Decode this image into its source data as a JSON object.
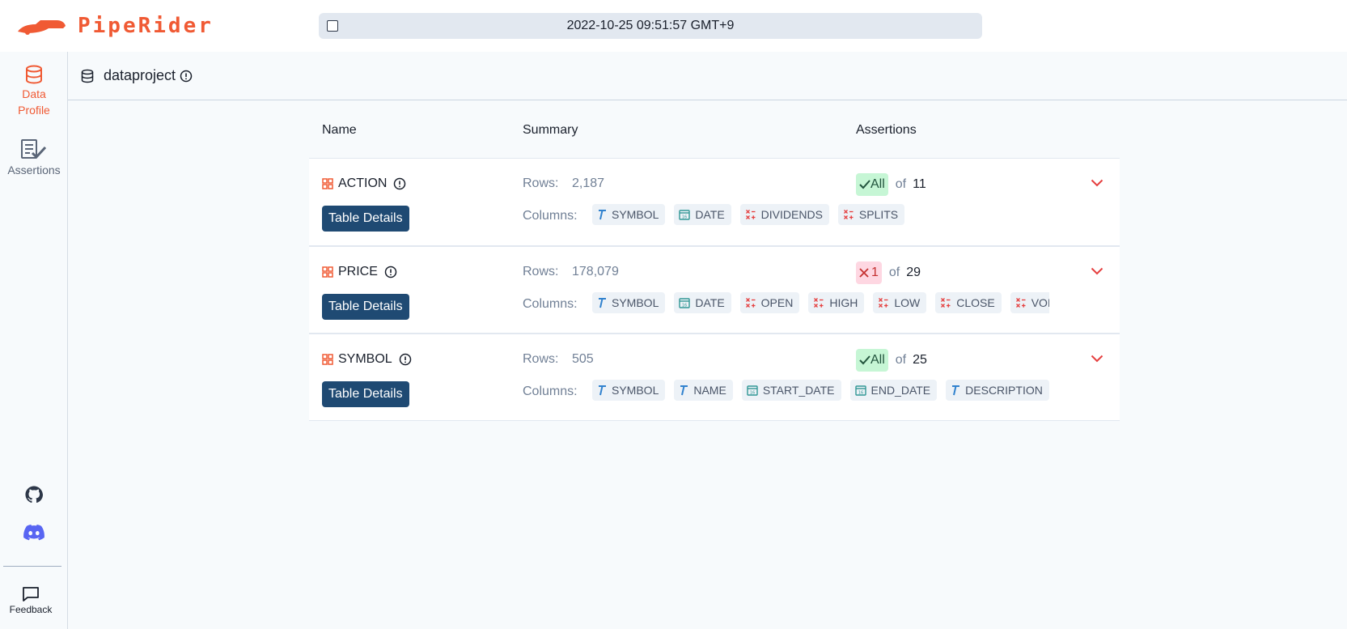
{
  "app": {
    "logo_text": "PipeRider",
    "timestamp": "2022-10-25 09:51:57 GMT+9"
  },
  "sidebar": {
    "items": [
      {
        "label_line1": "Data",
        "label_line2": "Profile",
        "icon": "database-icon",
        "active": true
      },
      {
        "label": "Assertions",
        "icon": "assertions-icon",
        "active": false
      }
    ],
    "social": [
      "github-icon",
      "discord-icon"
    ],
    "feedback_label": "Feedback"
  },
  "breadcrumb": {
    "title": "dataproject"
  },
  "table": {
    "headers": {
      "name": "Name",
      "summary": "Summary",
      "assertions": "Assertions"
    },
    "details_label": "Table Details",
    "rows_label": "Rows:",
    "columns_label": "Columns:",
    "of_label": "of",
    "rows": [
      {
        "name": "ACTION",
        "row_count": "2,187",
        "assert_status": "pass",
        "assert_badge": "All",
        "assert_total": "11",
        "columns": [
          {
            "name": "SYMBOL",
            "type": "text"
          },
          {
            "name": "DATE",
            "type": "datetime"
          },
          {
            "name": "DIVIDENDS",
            "type": "numeric"
          },
          {
            "name": "SPLITS",
            "type": "numeric"
          }
        ]
      },
      {
        "name": "PRICE",
        "row_count": "178,079",
        "assert_status": "fail",
        "assert_badge": "1",
        "assert_total": "29",
        "columns": [
          {
            "name": "SYMBOL",
            "type": "text"
          },
          {
            "name": "DATE",
            "type": "datetime"
          },
          {
            "name": "OPEN",
            "type": "numeric"
          },
          {
            "name": "HIGH",
            "type": "numeric"
          },
          {
            "name": "LOW",
            "type": "numeric"
          },
          {
            "name": "CLOSE",
            "type": "numeric"
          },
          {
            "name": "VOLUME",
            "type": "numeric"
          }
        ]
      },
      {
        "name": "SYMBOL",
        "row_count": "505",
        "assert_status": "pass",
        "assert_badge": "All",
        "assert_total": "25",
        "columns": [
          {
            "name": "SYMBOL",
            "type": "text"
          },
          {
            "name": "NAME",
            "type": "text"
          },
          {
            "name": "START_DATE",
            "type": "datetime"
          },
          {
            "name": "END_DATE",
            "type": "datetime"
          },
          {
            "name": "DESCRIPTION",
            "type": "text"
          },
          {
            "name": "",
            "type": "text"
          }
        ]
      }
    ]
  },
  "colors": {
    "brand": "#f05a34",
    "button": "#1f4a73",
    "pass_bg": "#c6f6d5",
    "fail_bg": "#fed7e2",
    "text_type": "#3182ce",
    "date_type": "#319795",
    "numeric_type": "#e53e3e"
  }
}
